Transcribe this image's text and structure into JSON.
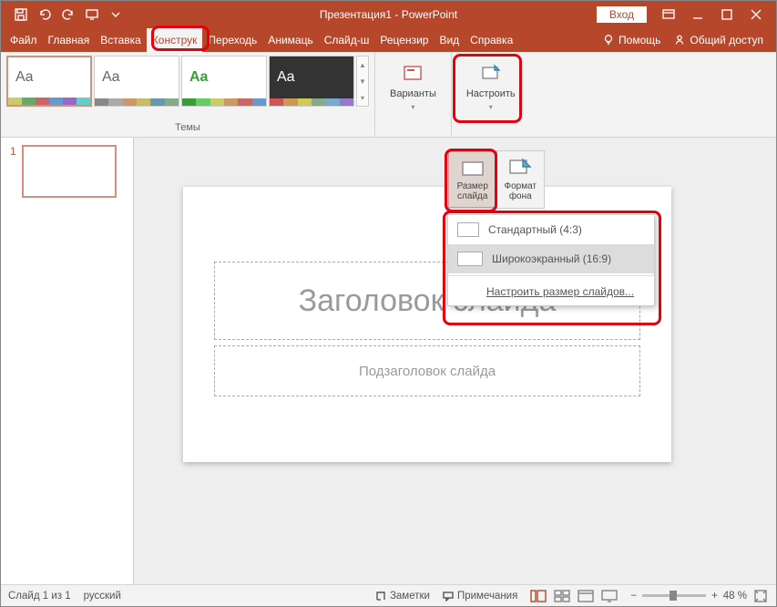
{
  "title": "Презентация1 - PowerPoint",
  "signin": "Вход",
  "qat": {
    "autosave_on": false
  },
  "tabs": {
    "file": "Файл",
    "home": "Главная",
    "insert": "Вставка",
    "design": "Конструк",
    "transitions": "Переходь",
    "animations": "Анимаць",
    "slideshow": "Слайд-ш",
    "review": "Рецензир",
    "view": "Вид",
    "help": "Справка",
    "tell_me": "Помощь",
    "share": "Общий доступ"
  },
  "ribbon": {
    "themes_label": "Темы",
    "variants_label": "Варианты",
    "setup_label": "Настроить"
  },
  "dropdown": {
    "slide_size": "Размер\nслайда",
    "format_bg": "Формат\nфона",
    "standard": "Стандартный (4:3)",
    "widescreen": "Широкоэкранный (16:9)",
    "custom": "Настроить размер слайдов..."
  },
  "slide": {
    "title_ph": "Заголовок слайда",
    "subtitle_ph": "Подзаголовок слайда",
    "thumb_number": "1"
  },
  "statusbar": {
    "slide_pos": "Слайд 1 из 1",
    "lang": "русский",
    "notes": "Заметки",
    "comments": "Примечания",
    "zoom_pct": "48 %",
    "zoom_minus": "−",
    "zoom_plus": "+"
  },
  "colors": {
    "brand": "#b7472a",
    "highlight": "#e3000f"
  }
}
